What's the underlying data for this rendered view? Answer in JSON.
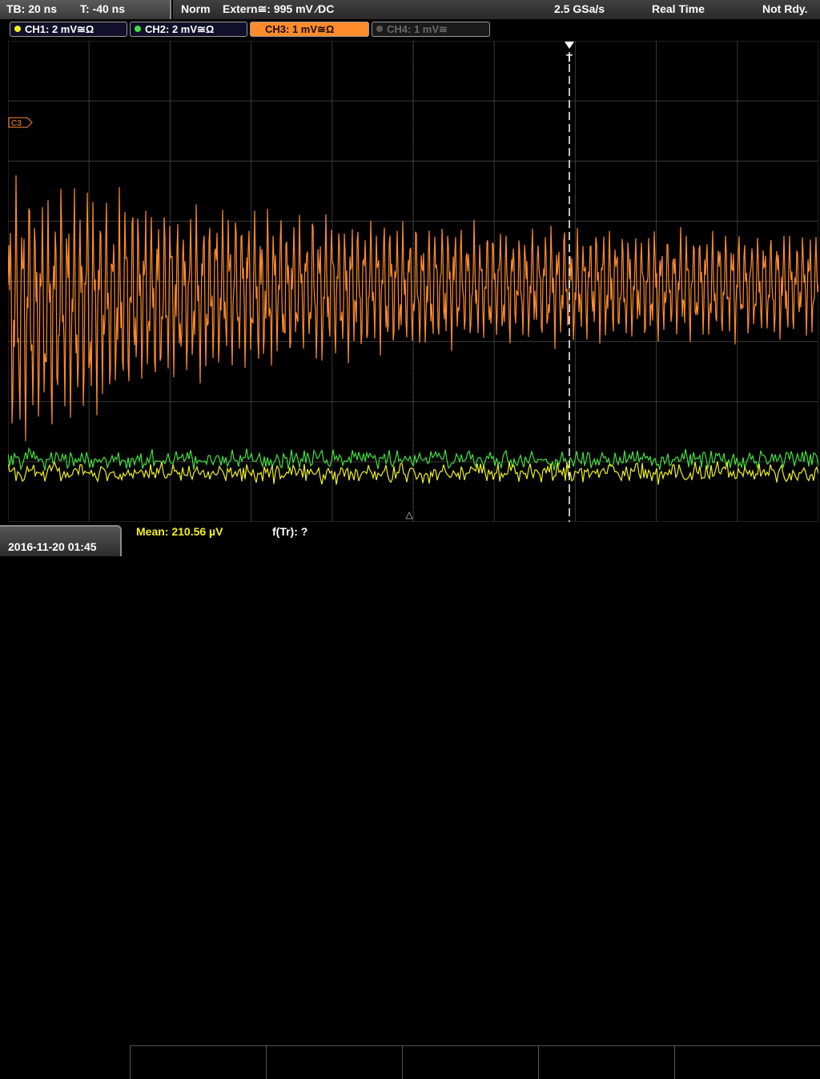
{
  "header": {
    "timebase": "TB: 20 ns",
    "trigger_time": "T: -40 ns",
    "trigger_mode": "Norm",
    "trigger_source": "Extern≅: 995 mV ⁄DC",
    "sample_rate": "2.5 GSa/s",
    "acq_mode": "Real Time",
    "status": "Not Rdy."
  },
  "channels": [
    {
      "label": "CH1: 2 mV≅Ω",
      "color": "#f0f020",
      "bg": "#10102a",
      "text": "#ffffff"
    },
    {
      "label": "CH2: 2 mV≅Ω",
      "color": "#40e040",
      "bg": "#10102a",
      "text": "#ffffff"
    },
    {
      "label": "CH3: 1 mV≅Ω",
      "color": "#ff8c2a",
      "bg": "#ff8c2a",
      "text": "#1a0a00"
    },
    {
      "label": "CH4: 1 mV≅",
      "color": "#5a5a5a",
      "bg": "#1a1a1a",
      "text": "#6a6a6a"
    }
  ],
  "markers": {
    "ch3": "C3",
    "trigger": "T"
  },
  "footer": {
    "datetime": "2016-11-20 01:45",
    "mean": "Mean: 210.56 µV",
    "freq": "f(Tr): ?"
  },
  "colors": {
    "grid": "#3a3a3a",
    "ch1": "#f0f020",
    "ch2": "#40e040",
    "ch3": "#ff8c2a",
    "trigger_line": "#ffffff"
  }
}
